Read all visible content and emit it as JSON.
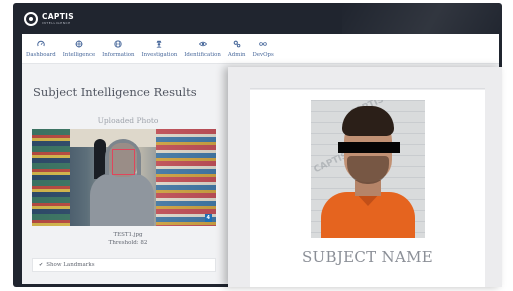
{
  "brand": {
    "name": "CAPTIS",
    "tagline": "INTELLIGENCE"
  },
  "nav": {
    "items": [
      {
        "label": "Dashboard",
        "icon": "gauge-icon"
      },
      {
        "label": "Intelligence",
        "icon": "target-icon"
      },
      {
        "label": "Information",
        "icon": "globe-icon"
      },
      {
        "label": "Investigation",
        "icon": "detective-icon"
      },
      {
        "label": "Identification",
        "icon": "eye-icon"
      },
      {
        "label": "Admin",
        "icon": "gears-icon"
      },
      {
        "label": "DevOps",
        "icon": "infinity-icon"
      }
    ]
  },
  "results": {
    "title": "Subject Intelligence Results",
    "uploaded_label": "Uploaded Photo",
    "filename": "TEST1.jpg",
    "threshold": "Threshold: 82",
    "landmarks_label": "Show Landmarks"
  },
  "match": {
    "watermark": "CAPTIS",
    "subject_name": "SUBJECT NAME"
  },
  "colors": {
    "frame": "#20252f",
    "nav_text": "#47679a",
    "face_box": "#e0455c",
    "shirt": "#e5641f"
  }
}
